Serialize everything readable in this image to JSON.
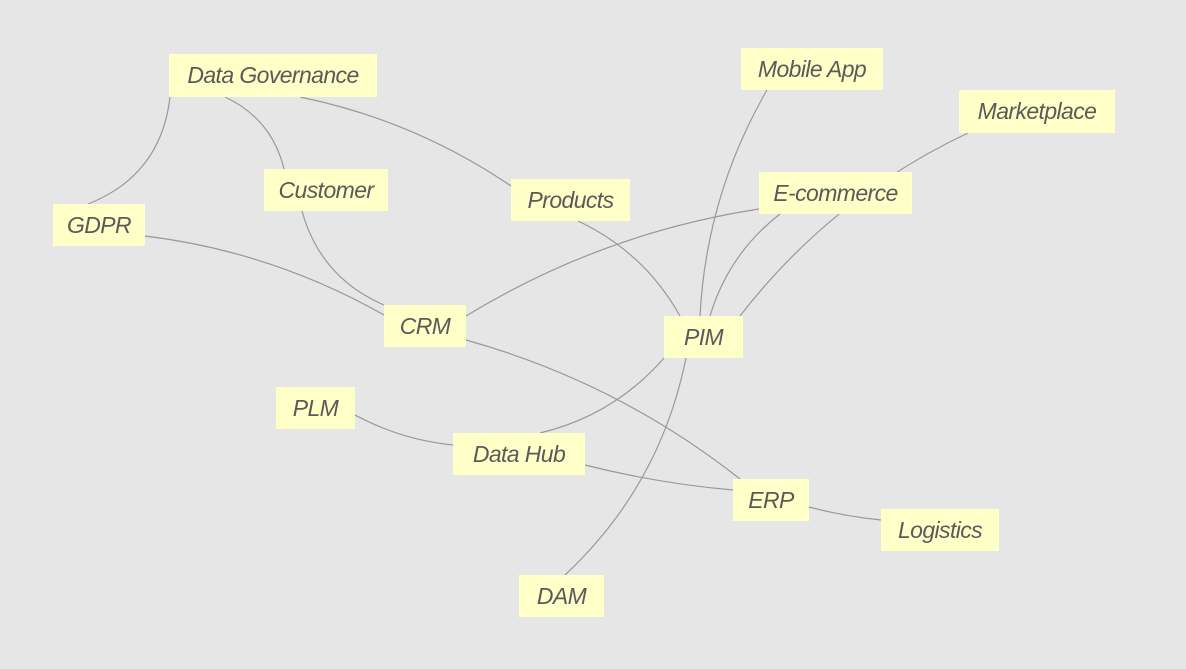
{
  "diagram": {
    "background_color": "#e6e6e6",
    "node_color": "#ffffc8",
    "edge_color": "#999999",
    "text_color": "#5a5a5a",
    "nodes": [
      {
        "id": "data-governance",
        "label": "Data Governance"
      },
      {
        "id": "mobile-app",
        "label": "Mobile App"
      },
      {
        "id": "marketplace",
        "label": "Marketplace"
      },
      {
        "id": "customer",
        "label": "Customer"
      },
      {
        "id": "products",
        "label": "Products"
      },
      {
        "id": "e-commerce",
        "label": "E-commerce"
      },
      {
        "id": "gdpr",
        "label": "GDPR"
      },
      {
        "id": "crm",
        "label": "CRM"
      },
      {
        "id": "pim",
        "label": "PIM"
      },
      {
        "id": "plm",
        "label": "PLM"
      },
      {
        "id": "data-hub",
        "label": "Data Hub"
      },
      {
        "id": "erp",
        "label": "ERP"
      },
      {
        "id": "logistics",
        "label": "Logistics"
      },
      {
        "id": "dam",
        "label": "DAM"
      }
    ],
    "edges": [
      [
        "data-governance",
        "gdpr"
      ],
      [
        "data-governance",
        "customer"
      ],
      [
        "customer",
        "crm"
      ],
      [
        "data-governance",
        "products"
      ],
      [
        "products",
        "pim"
      ],
      [
        "gdpr",
        "crm"
      ],
      [
        "crm",
        "e-commerce"
      ],
      [
        "crm",
        "erp"
      ],
      [
        "pim",
        "mobile-app"
      ],
      [
        "pim",
        "e-commerce"
      ],
      [
        "pim",
        "marketplace"
      ],
      [
        "pim",
        "data-hub"
      ],
      [
        "pim",
        "dam"
      ],
      [
        "plm",
        "data-hub"
      ],
      [
        "data-hub",
        "erp"
      ],
      [
        "erp",
        "logistics"
      ]
    ]
  }
}
